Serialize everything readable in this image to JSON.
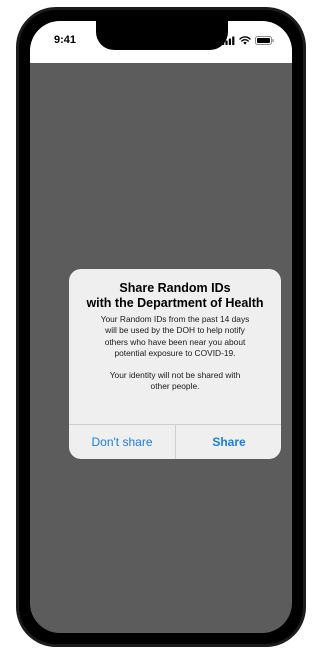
{
  "status_bar": {
    "time": "9:41",
    "icons": [
      "cellular-signal-icon",
      "wifi-icon",
      "battery-icon"
    ]
  },
  "dialog": {
    "title_lines": [
      "Share Random IDs",
      "with the Department of Health"
    ],
    "body_lines": [
      "Your Random IDs from the past 14 days",
      "will be used by the DOH to help notify",
      "others who have been near you about",
      "potential exposure to COVID-19."
    ],
    "note_lines": [
      "Your identity will not be shared with",
      "other people."
    ],
    "buttons": {
      "cancel_label": "Don't share",
      "confirm_label": "Share"
    }
  },
  "colors": {
    "button_text": "#1a7ee0",
    "screen_dim": "#5c5c5c",
    "dialog_bg": "#efefef",
    "device_frame": "#1c1c1e"
  }
}
